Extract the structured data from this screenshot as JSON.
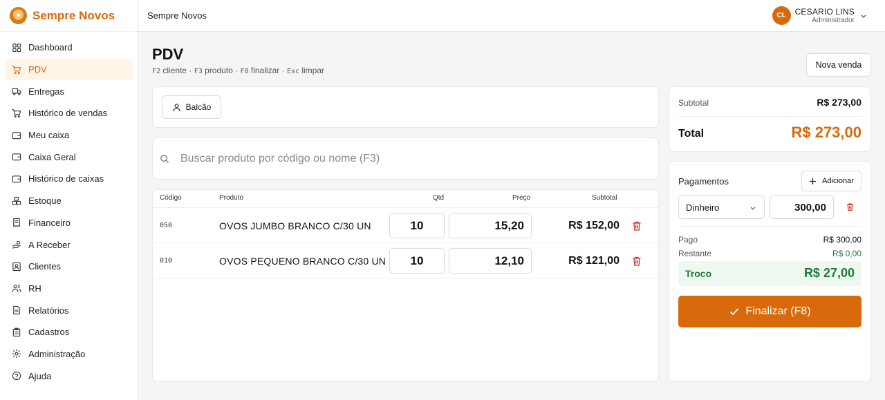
{
  "app": {
    "brand": "Sempre Novos",
    "title": "Sempre Novos"
  },
  "user": {
    "initials": "CL",
    "name": "CESARIO LINS",
    "role": "Administrador"
  },
  "sidebar": {
    "items": [
      {
        "label": "Dashboard",
        "icon": "grid-icon"
      },
      {
        "label": "PDV",
        "icon": "cart-icon"
      },
      {
        "label": "Entregas",
        "icon": "truck-icon"
      },
      {
        "label": "Histórico de vendas",
        "icon": "cart-icon"
      },
      {
        "label": "Meu caixa",
        "icon": "wallet-icon"
      },
      {
        "label": "Caixa Geral",
        "icon": "wallet-icon"
      },
      {
        "label": "Histórico de caixas",
        "icon": "wallet-icon"
      },
      {
        "label": "Estoque",
        "icon": "boxes-icon"
      },
      {
        "label": "Financeiro",
        "icon": "receipt-icon"
      },
      {
        "label": "A Receber",
        "icon": "hand-coins-icon"
      },
      {
        "label": "Clientes",
        "icon": "contact-icon"
      },
      {
        "label": "RH",
        "icon": "users-icon"
      },
      {
        "label": "Relatórios",
        "icon": "file-icon"
      },
      {
        "label": "Cadastros",
        "icon": "clipboard-icon"
      },
      {
        "label": "Administração",
        "icon": "gear-icon"
      },
      {
        "label": "Ajuda",
        "icon": "help-icon"
      }
    ]
  },
  "pdv": {
    "title": "PDV",
    "shortcuts": [
      {
        "key": "F2",
        "label": "cliente"
      },
      {
        "key": "F3",
        "label": "produto"
      },
      {
        "key": "F8",
        "label": "finalizar"
      },
      {
        "key": "Esc",
        "label": "limpar"
      }
    ],
    "new_sale_label": "Nova venda",
    "customer_label": "Balcão",
    "search_placeholder": "Buscar produto por código ou nome (F3)",
    "columns": {
      "code": "Código",
      "product": "Produto",
      "qty": "Qtd",
      "price": "Preço",
      "subtotal": "Subtotal"
    },
    "items": [
      {
        "code": "050",
        "name": "OVOS JUMBO BRANCO C/30 UN",
        "qty": "10",
        "price": "15,20",
        "subtotal": "R$ 152,00"
      },
      {
        "code": "010",
        "name": "OVOS PEQUENO BRANCO C/30 UN",
        "qty": "10",
        "price": "12,10",
        "subtotal": "R$ 121,00"
      }
    ]
  },
  "summary": {
    "subtotal_label": "Subtotal",
    "subtotal": "R$ 273,00",
    "total_label": "Total",
    "total": "R$ 273,00"
  },
  "payments": {
    "title": "Pagamentos",
    "add_label": "Adicionar",
    "method": "Dinheiro",
    "amount": "300,00",
    "paid_label": "Pago",
    "paid": "R$ 300,00",
    "remaining_label": "Restante",
    "remaining": "R$ 0,00",
    "change_label": "Troco",
    "change": "R$ 27,00",
    "finalize_label": "Finalizar (F8)"
  },
  "colors": {
    "accent": "#d96a0b",
    "danger": "#dc2626",
    "success": "#1f7a3a",
    "success_bg": "#eef8f0"
  }
}
